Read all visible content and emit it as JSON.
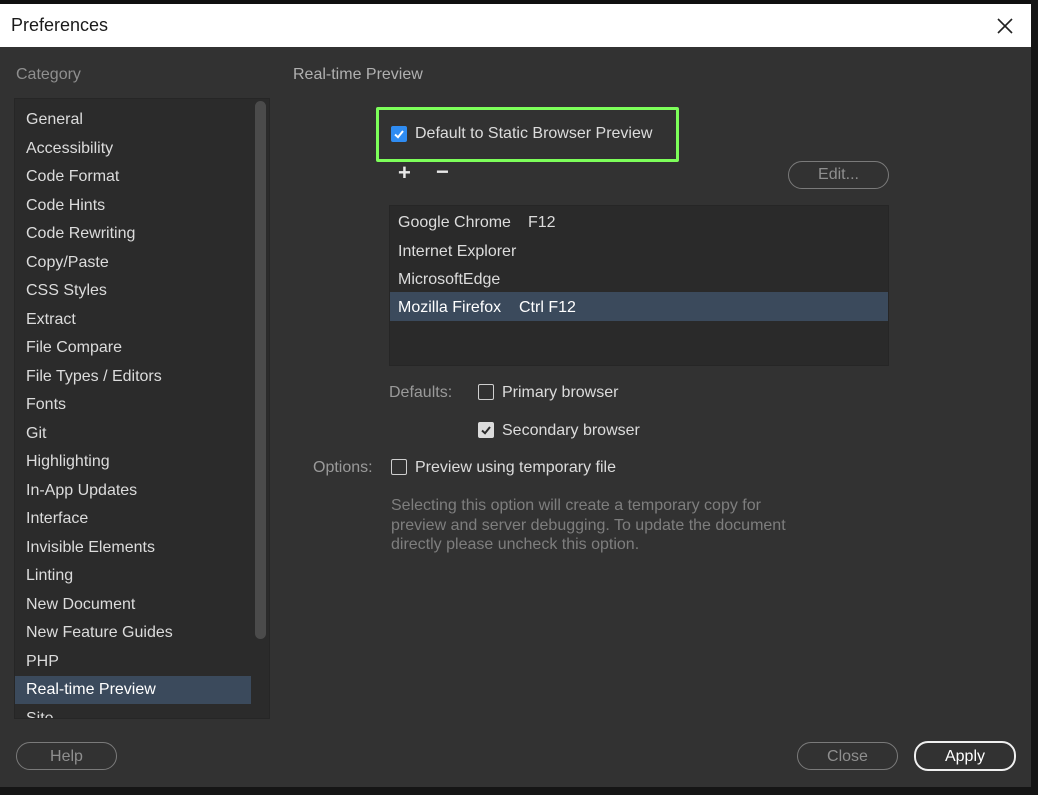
{
  "dialog": {
    "title": "Preferences"
  },
  "category": {
    "heading": "Category",
    "items": [
      "General",
      "Accessibility",
      "Code Format",
      "Code Hints",
      "Code Rewriting",
      "Copy/Paste",
      "CSS Styles",
      "Extract",
      "File Compare",
      "File Types / Editors",
      "Fonts",
      "Git",
      "Highlighting",
      "In-App Updates",
      "Interface",
      "Invisible Elements",
      "Linting",
      "New Document",
      "New Feature Guides",
      "PHP",
      "Real-time Preview",
      "Site"
    ],
    "selected": "Real-time Preview"
  },
  "panel": {
    "heading": "Real-time Preview",
    "static_preview": {
      "label": "Default to Static Browser Preview",
      "checked": true
    },
    "add_symbol": "+",
    "remove_symbol": "−",
    "edit_button": "Edit...",
    "browsers": [
      {
        "name": "Google Chrome",
        "shortcut": "F12"
      },
      {
        "name": "Internet Explorer",
        "shortcut": ""
      },
      {
        "name": "MicrosoftEdge",
        "shortcut": ""
      },
      {
        "name": "Mozilla Firefox",
        "shortcut": "Ctrl F12",
        "selected": true
      }
    ],
    "defaults_label": "Defaults:",
    "primary_browser": {
      "label": "Primary browser",
      "checked": false
    },
    "secondary_browser": {
      "label": "Secondary browser",
      "checked": true
    },
    "options_label": "Options:",
    "temp_file": {
      "label": "Preview using temporary file",
      "checked": false
    },
    "help_text": "Selecting this option will create a temporary copy for preview and server debugging. To update the document directly please uncheck this option."
  },
  "footer": {
    "help": "Help",
    "close": "Close",
    "apply": "Apply"
  },
  "icons": {
    "close": "close-icon",
    "check": "checkmark-icon"
  },
  "colors": {
    "accent": "#2f8cf2",
    "highlight": "#7dff5a",
    "selection": "#3b4a5c"
  }
}
